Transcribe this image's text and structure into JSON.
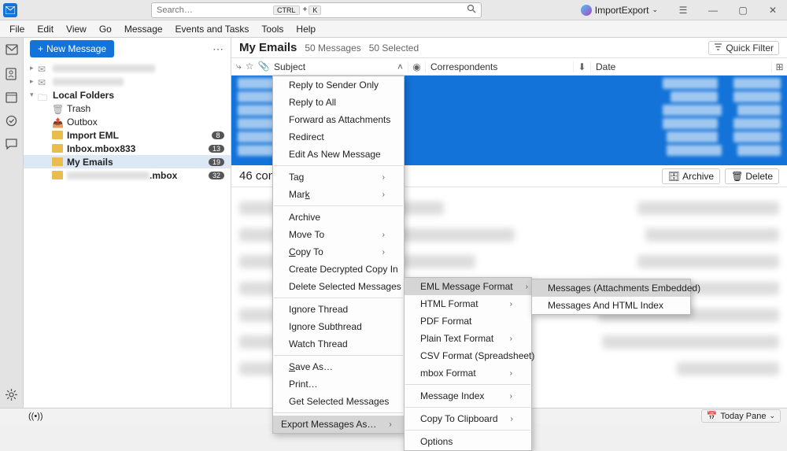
{
  "titlebar": {
    "search_placeholder": "Search…",
    "kbd1": "CTRL",
    "kbd_plus": "+",
    "kbd2": "K",
    "import_export": "ImportExport"
  },
  "menu": {
    "file": "File",
    "edit": "Edit",
    "view": "View",
    "go": "Go",
    "message": "Message",
    "events": "Events and Tasks",
    "tools": "Tools",
    "help": "Help"
  },
  "toolbar": {
    "new_message": "New Message"
  },
  "folders": {
    "local_folders": "Local Folders",
    "trash": "Trash",
    "outbox": "Outbox",
    "import_eml": "Import EML",
    "import_eml_badge": "8",
    "inbox_mbox": "Inbox.mbox833",
    "inbox_mbox_badge": "13",
    "my_emails": "My Emails",
    "my_emails_badge": "19",
    "mbox_suffix": ".mbox",
    "mbox_badge": "32"
  },
  "header": {
    "title": "My Emails",
    "messages": "50 Messages",
    "selected": "50 Selected",
    "quick_filter": "Quick Filter"
  },
  "columns": {
    "subject": "Subject",
    "correspondents": "Correspondents",
    "date": "Date"
  },
  "conversations": {
    "title": "46 conv",
    "archive": "Archive",
    "delete": "Delete"
  },
  "ctx1": {
    "reply_sender": "Reply to Sender Only",
    "reply_all": "Reply to All",
    "fwd_attach": "Forward as Attachments",
    "redirect": "Redirect",
    "edit_new": "Edit As New Message",
    "tag": "Tag",
    "mark": "Mar",
    "mark_k": "k",
    "archive": "Archive",
    "move": "Move To",
    "copy": "Copy To",
    "decrypted": "Create Decrypted Copy In",
    "delete_sel": "Delete Selected Messages",
    "ignore_thread": "Ignore Thread",
    "ignore_sub": "Ignore Subthread",
    "watch": "Watch Thread",
    "save_pre": "S",
    "save_post": "ave As…",
    "print": "Print…",
    "get_sel": "Get Selected Messages",
    "export": "Export Messages As…"
  },
  "ctx2": {
    "eml": "EML Message Format",
    "html": "HTML Format",
    "pdf": "PDF Format",
    "plain": "Plain Text Format",
    "csv": "CSV Format (Spreadsheet)",
    "mbox": "mbox Format",
    "index": "Message Index",
    "clipboard": "Copy To Clipboard",
    "options": "Options"
  },
  "ctx3": {
    "embedded": "Messages (Attachments Embedded)",
    "html_index": "Messages And HTML Index"
  },
  "statusbar": {
    "today_pane": "Today Pane"
  }
}
